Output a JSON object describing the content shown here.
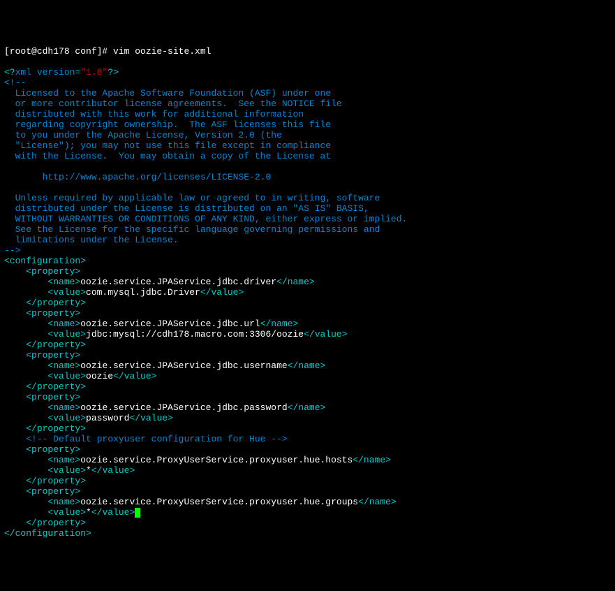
{
  "prompt": "[root@cdh178 conf]# vim oozie-site.xml",
  "xml_decl_open": "<?",
  "xml_decl_name": "xml version",
  "xml_decl_eq": "=",
  "xml_decl_val": "\"1.0\"",
  "xml_decl_close": "?>",
  "comment_open": "<!--",
  "license_l1": "  Licensed to the Apache Software Foundation (ASF) under one",
  "license_l2": "  or more contributor license agreements.  See the NOTICE file",
  "license_l3": "  distributed with this work for additional information",
  "license_l4": "  regarding copyright ownership.  The ASF licenses this file",
  "license_l5": "  to you under the Apache License, Version 2.0 (the",
  "license_l6": "  \"License\"); you may not use this file except in compliance",
  "license_l7": "  with the License.  You may obtain a copy of the License at",
  "license_url": "       http://www.apache.org/licenses/LICENSE-2.0",
  "license_l8": "  Unless required by applicable law or agreed to in writing, software",
  "license_l9": "  distributed under the License is distributed on an \"AS IS\" BASIS,",
  "license_l10": "  WITHOUT WARRANTIES OR CONDITIONS OF ANY KIND, either express or implied.",
  "license_l11": "  See the License for the specific language governing permissions and",
  "license_l12": "  limitations under the License.",
  "comment_close": "-->",
  "tag_configuration_open": "<configuration>",
  "tag_property_open": "<property>",
  "tag_property_close": "</property>",
  "tag_name_open": "<name>",
  "tag_name_close": "</name>",
  "tag_value_open": "<value>",
  "tag_value_close": "</value>",
  "tag_configuration_close": "</configuration>",
  "p1_name": "oozie.service.JPAService.jdbc.driver",
  "p1_value": "com.mysql.jdbc.Driver",
  "p2_name": "oozie.service.JPAService.jdbc.url",
  "p2_value": "jdbc:mysql://cdh178.macro.com:3306/oozie",
  "p3_name": "oozie.service.JPAService.jdbc.username",
  "p3_value": "oozie",
  "p4_name": "oozie.service.JPAService.jdbc.password",
  "p4_value": "password",
  "comment_hue": "<!-- Default proxyuser configuration for Hue -->",
  "p5_name": "oozie.service.ProxyUserService.proxyuser.hue.hosts",
  "p5_value": "*",
  "p6_name": "oozie.service.ProxyUserService.proxyuser.hue.groups",
  "p6_value": "*",
  "indent1": "    ",
  "indent2": "        "
}
